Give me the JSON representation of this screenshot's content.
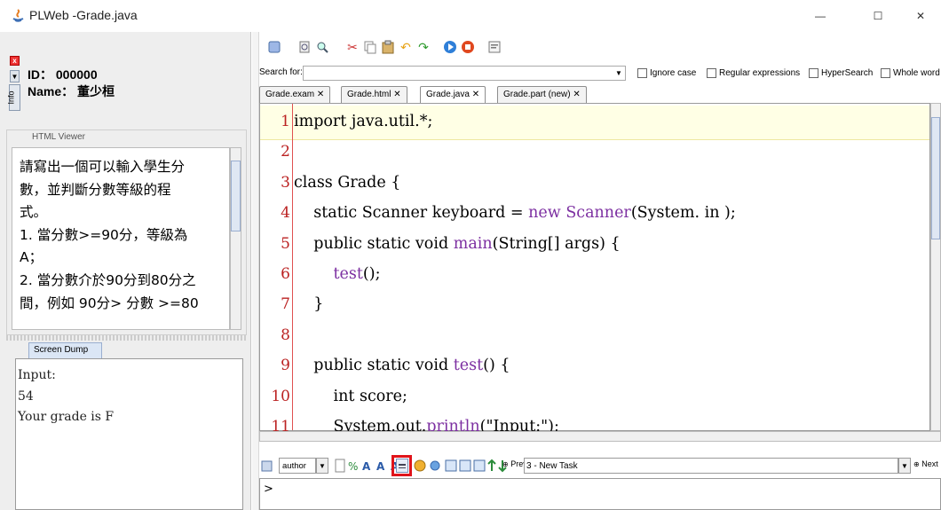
{
  "window": {
    "title": "PLWeb -Grade.java",
    "controls": [
      "—",
      "☐",
      "✕"
    ]
  },
  "student": {
    "id_line": "ID： 000000",
    "name_line": "Name： 董少桓",
    "info_tab": "Info"
  },
  "html_viewer": {
    "label": "HTML Viewer",
    "lines": [
      "請寫出一個可以輸入學生分",
      "數，並判斷分數等級的程",
      "式。",
      "1. 當分數>=90分，等級為",
      "A；",
      "2. 當分數介於90分到80分之",
      "間，例如 90分> 分數 >=80"
    ]
  },
  "screen_dump": {
    "tab": "Screen Dump",
    "lines": [
      "Input:",
      "54",
      "Your grade is F"
    ]
  },
  "search": {
    "label": "Search for:",
    "value": "",
    "options": [
      "Ignore case",
      "Regular expressions",
      "HyperSearch",
      "Whole word"
    ]
  },
  "file_tabs": [
    {
      "label": "Grade.exam",
      "close": "✕"
    },
    {
      "label": "Grade.html",
      "close": "✕"
    },
    {
      "label": "Grade.java",
      "close": "✕"
    },
    {
      "label": "Grade.part (new)",
      "close": "✕"
    }
  ],
  "editor": {
    "line_numbers": [
      "1",
      "2",
      "3",
      "4",
      "5",
      "6",
      "7",
      "8",
      "9",
      "10",
      "11"
    ],
    "lines": [
      [
        {
          "t": "import java.util.*;"
        }
      ],
      [
        {
          "t": ""
        }
      ],
      [
        {
          "t": "class Grade {"
        }
      ],
      [
        {
          "t": "    static Scanner keyboard = "
        },
        {
          "t": "new",
          "k": 1
        },
        {
          "t": " "
        },
        {
          "t": "Scanner",
          "k": 1
        },
        {
          "t": "(System. in );"
        }
      ],
      [
        {
          "t": "    public static void "
        },
        {
          "t": "main",
          "k": 1
        },
        {
          "t": "(String[] args) {"
        }
      ],
      [
        {
          "t": "        "
        },
        {
          "t": "test",
          "k": 1
        },
        {
          "t": "();"
        }
      ],
      [
        {
          "t": "    }"
        }
      ],
      [
        {
          "t": ""
        }
      ],
      [
        {
          "t": "    public static void "
        },
        {
          "t": "test",
          "k": 1
        },
        {
          "t": "() {"
        }
      ],
      [
        {
          "t": "        int score;"
        }
      ],
      [
        {
          "t": "        System.out."
        },
        {
          "t": "println",
          "k": 1
        },
        {
          "t": "(\"Input:\");"
        }
      ]
    ]
  },
  "bottom": {
    "author": "author",
    "prev": "Prev",
    "task": "3 - New Task",
    "next": "Next",
    "console_prompt": ">"
  }
}
